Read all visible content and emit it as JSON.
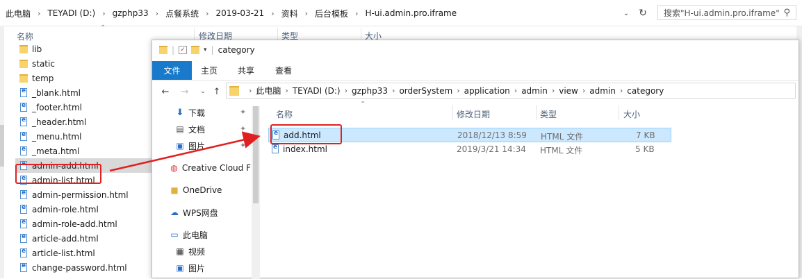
{
  "background": {
    "breadcrumbs": [
      "此电脑",
      "TEYADI (D:)",
      "gzphp33",
      "点餐系统",
      "2019-03-21",
      "资料",
      "后台模板",
      "H-ui.admin.pro.iframe"
    ],
    "search_placeholder": "搜索\"H-ui.admin.pro.iframe\"",
    "columns": {
      "name": "名称",
      "date": "修改日期",
      "type": "类型",
      "size": "大小"
    },
    "items": [
      {
        "kind": "folder",
        "name": "lib"
      },
      {
        "kind": "folder",
        "name": "static"
      },
      {
        "kind": "folder",
        "name": "temp"
      },
      {
        "kind": "file",
        "name": "_blank.html"
      },
      {
        "kind": "file",
        "name": "_footer.html"
      },
      {
        "kind": "file",
        "name": "_header.html"
      },
      {
        "kind": "file",
        "name": "_menu.html"
      },
      {
        "kind": "file",
        "name": "_meta.html"
      },
      {
        "kind": "file",
        "name": "admin-add.html",
        "selected": true
      },
      {
        "kind": "file",
        "name": "admin-list.html"
      },
      {
        "kind": "file",
        "name": "admin-permission.html"
      },
      {
        "kind": "file",
        "name": "admin-role.html"
      },
      {
        "kind": "file",
        "name": "admin-role-add.html"
      },
      {
        "kind": "file",
        "name": "article-add.html"
      },
      {
        "kind": "file",
        "name": "article-list.html"
      },
      {
        "kind": "file",
        "name": "change-password.html"
      }
    ]
  },
  "window": {
    "title": "category",
    "ribbon_tabs": [
      "文件",
      "主页",
      "共享",
      "查看"
    ],
    "breadcrumbs": [
      "此电脑",
      "TEYADI (D:)",
      "gzphp33",
      "orderSystem",
      "application",
      "admin",
      "view",
      "admin",
      "category"
    ],
    "nav_items": [
      {
        "name": "下载",
        "icon": "download-icon",
        "pinned": true
      },
      {
        "name": "文档",
        "icon": "document-icon",
        "pinned": true
      },
      {
        "name": "图片",
        "icon": "picture-icon",
        "pinned": true
      },
      {
        "name": "Creative Cloud F",
        "icon": "creative-cloud-icon"
      },
      {
        "name": "OneDrive",
        "icon": "folder-icon"
      },
      {
        "name": "WPS网盘",
        "icon": "cloud-icon"
      },
      {
        "name": "此电脑",
        "icon": "computer-icon"
      },
      {
        "name": "视频",
        "icon": "video-icon"
      },
      {
        "name": "图片",
        "icon": "picture-icon"
      }
    ],
    "columns": {
      "name": "名称",
      "date": "修改日期",
      "type": "类型",
      "size": "大小"
    },
    "files": [
      {
        "name": "add.html",
        "date": "2018/12/13 8:59",
        "type": "HTML 文件",
        "size": "7 KB",
        "selected": true
      },
      {
        "name": "index.html",
        "date": "2019/3/21 14:34",
        "type": "HTML 文件",
        "size": "5 KB"
      }
    ]
  },
  "colors": {
    "accent": "#1979ca",
    "highlight": "#e02020",
    "selection": "#cce8ff"
  }
}
